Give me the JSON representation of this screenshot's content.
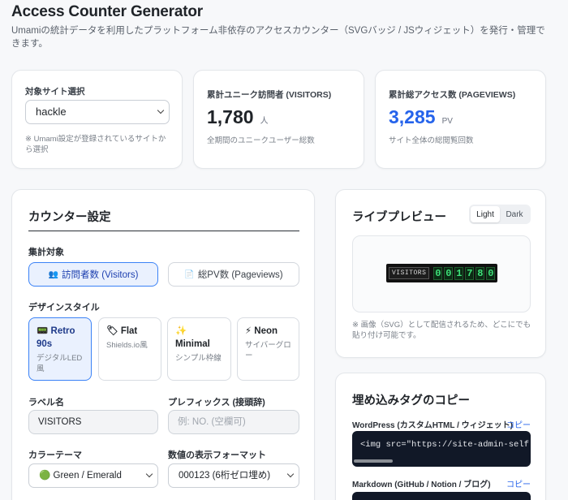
{
  "header": {
    "title": "Access Counter Generator",
    "description": "Umamiの統計データを利用したプラットフォーム非依存のアクセスカウンター（SVGバッジ / JSウィジェット）を発行・管理できます。"
  },
  "site_card": {
    "label": "対象サイト選択",
    "selected": "hackle",
    "note": "※ Umami設定が登録されているサイトから選択"
  },
  "visitors_card": {
    "label": "累計ユニーク訪問者 (VISITORS)",
    "value": "1,780",
    "unit": "人",
    "note": "全期間のユニークユーザー総数"
  },
  "pageviews_card": {
    "label": "累計総アクセス数 (PAGEVIEWS)",
    "value": "3,285",
    "unit": "PV",
    "note": "サイト全体の総閲覧回数",
    "accent": "#2563eb"
  },
  "settings": {
    "title": "カウンター設定",
    "target_label": "集計対象",
    "targets": [
      {
        "icon": "people-icon",
        "glyph": "👥",
        "label": "訪問者数 (Visitors)",
        "active": true
      },
      {
        "icon": "document-icon",
        "glyph": "📄",
        "label": "総PV数 (Pageviews)",
        "active": false
      }
    ],
    "style_label": "デザインスタイル",
    "styles": [
      {
        "icon": "retro-icon",
        "glyph": "📟",
        "name": "Retro 90s",
        "desc": "デジタルLED風",
        "active": true
      },
      {
        "icon": "flat-icon",
        "glyph": "🏷",
        "name": "Flat",
        "desc": "Shields.io風",
        "active": false
      },
      {
        "icon": "sparkle-icon",
        "glyph": "✨",
        "name": "Minimal",
        "desc": "シンプル枠線",
        "active": false
      },
      {
        "icon": "lightning-icon",
        "glyph": "⚡",
        "name": "Neon",
        "desc": "サイバーグロー",
        "active": false
      }
    ],
    "label_name_label": "ラベル名",
    "label_name_value": "VISITORS",
    "prefix_label": "プレフィックス (接頭辞)",
    "prefix_placeholder": "例: NO. (空欄可)",
    "color_label": "カラーテーマ",
    "color_value": "🟢 Green / Emerald",
    "format_label": "数値の表示フォーマット",
    "format_value": "000123 (6桁ゼロ埋め)"
  },
  "preview": {
    "title": "ライブプレビュー",
    "toggle_light": "Light",
    "toggle_dark": "Dark",
    "badge_label": "VISITORS",
    "digits": [
      "0",
      "0",
      "1",
      "7",
      "8",
      "0"
    ],
    "note": "※ 画像（SVG）として配信されるため、どこにでも貼り付け可能です。"
  },
  "embed": {
    "title": "埋め込みタグのコピー",
    "items": [
      {
        "label": "WordPress (カスタムHTML / ウィジェット)",
        "copy": "コピー",
        "code": "<img src=\"https://site-admin-self.hac"
      },
      {
        "label": "Markdown (GitHub / Notion / ブログ)",
        "copy": "コピー",
        "code": ""
      }
    ]
  }
}
